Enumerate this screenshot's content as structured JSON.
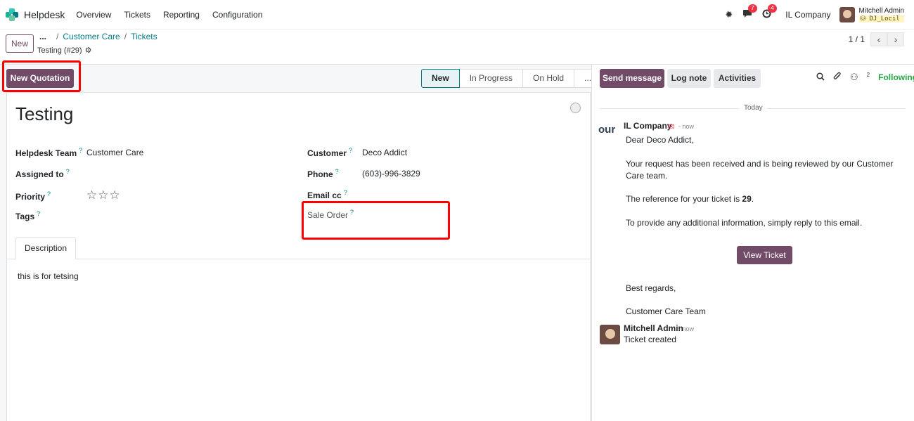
{
  "nav": {
    "app_name": "Helpdesk",
    "menu": [
      "Overview",
      "Tickets",
      "Reporting",
      "Configuration"
    ],
    "messages_badge": "7",
    "activities_badge": "4",
    "company": "IL Company",
    "user_name": "Mitchell Admin",
    "db_name": "DJ_Locil"
  },
  "control": {
    "new_label": "New",
    "breadcrumb_dots": "...",
    "breadcrumb_1": "Customer Care",
    "breadcrumb_2": "Tickets",
    "record": "Testing (#29)",
    "pager": "1 / 1"
  },
  "statusbar": {
    "quotation": "New Quotation",
    "stages": [
      "New",
      "In Progress",
      "On Hold",
      "..."
    ],
    "active_stage": "New"
  },
  "form": {
    "title": "Testing",
    "helpdesk_team_label": "Helpdesk Team",
    "helpdesk_team_value": "Customer Care",
    "assigned_label": "Assigned to",
    "priority_label": "Priority",
    "priority_stars": "☆☆☆",
    "tags_label": "Tags",
    "customer_label": "Customer",
    "customer_value": "Deco Addict",
    "phone_label": "Phone",
    "phone_value": "(603)-996-3829",
    "emailcc_label": "Email cc",
    "sale_order_label": "Sale Order",
    "help_mark": "?",
    "tab_description": "Description",
    "description": "this is for tetsing"
  },
  "chatter": {
    "send": "Send message",
    "log": "Log note",
    "activities": "Activities",
    "followers_count": "2",
    "following": "Following",
    "today": "Today",
    "logo_text": "our",
    "msg1_author": "IL Company",
    "msg1_time": "- now",
    "msg1_greeting": "Dear Deco Addict,",
    "msg1_p1": "Your request has been received and is being reviewed by our Customer Care team.",
    "msg1_p2_prefix": "The reference for your ticket is ",
    "msg1_p2_ref": "29",
    "msg1_p2_suffix": ".",
    "msg1_p3": "To provide any additional information, simply reply to this email.",
    "view_ticket": "View Ticket",
    "msg1_regards": "Best regards,",
    "msg1_team": "Customer Care Team",
    "msg2_author": "Mitchell Admin",
    "msg2_time": "- now",
    "msg2_body": "Ticket created"
  }
}
